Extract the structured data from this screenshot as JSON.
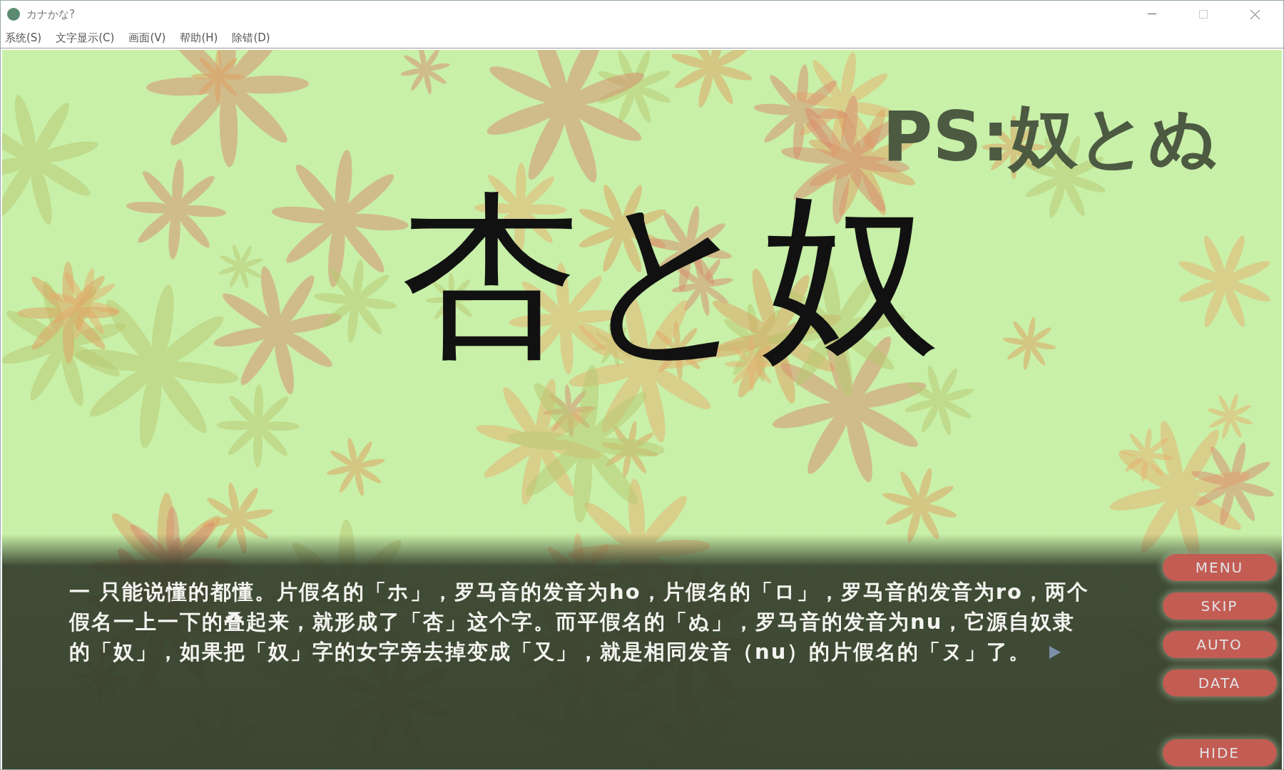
{
  "window": {
    "title": "カナかな?"
  },
  "menu": [
    "系统(S)",
    "文字显示(C)",
    "画面(V)",
    "帮助(H)",
    "除错(D)"
  ],
  "scene": {
    "subtitle": "PS:奴とぬ",
    "title": "杏と奴"
  },
  "dialog": {
    "text": "一  只能说懂的都懂。片假名的「ホ」，罗马音的发音为ho，片假名的「ロ」，罗马音的发音为ro，两个假名一上一下的叠起来，就形成了「杏」这个字。而平假名的「ぬ」，罗马音的发音为nu，它源自奴隶的「奴」，如果把「奴」字的女字旁去掉变成「又」，就是相同发音（nu）的片假名的「ヌ」了。"
  },
  "side_buttons": [
    "MENU",
    "SKIP",
    "AUTO",
    "DATA"
  ],
  "hide_button": "HIDE"
}
